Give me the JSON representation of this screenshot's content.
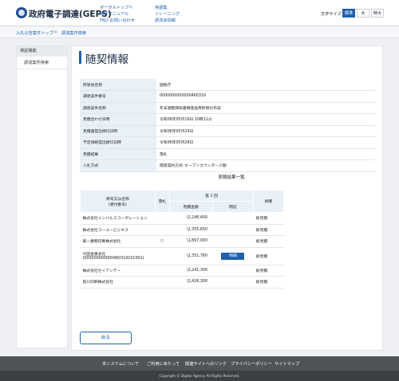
{
  "header": {
    "brand": "政府電子調達(GEPS)",
    "links_col1": [
      "ポータルトップへ",
      "操作マニュアル",
      "FAQ･お問い合わせ"
    ],
    "links_col2": [
      "用語集",
      "トレーニング",
      "調達会情報"
    ],
    "font_size_label": "文字サイズ",
    "font_sizes": [
      "標準",
      "大",
      "特大"
    ],
    "font_size_selected": "標準"
  },
  "breadcrumb": {
    "items": [
      "入札公告案件トップ",
      "調達案件検索"
    ],
    "separator": ">"
  },
  "sidebar": {
    "heading": "検証機能",
    "items": [
      "調達案件検索"
    ]
  },
  "page": {
    "title": "随契情報"
  },
  "info": [
    {
      "label": "所管省名称",
      "value": "国税庁"
    },
    {
      "label": "調達案件番号",
      "value": "0000000000000460319"
    },
    {
      "label": "調達案件名称",
      "value": "年末調整関係書類発送用封筒の作成"
    },
    {
      "label": "見積合わせ日時",
      "value": "令和06年05月16日 10時11分"
    },
    {
      "label": "見積書提出締切日時",
      "value": "令和06年05月29日"
    },
    {
      "label": "予定価格提出締切日時",
      "value": "令和06年05月28日"
    },
    {
      "label": "見積結果",
      "value": "落札"
    },
    {
      "label": "入札方式",
      "value": "随意契約方式･オープンカウンター少額"
    }
  ],
  "results": {
    "title": "見積結果一覧",
    "col_supplier": "商号又は名称",
    "col_supplier_sub": "(受付番号)",
    "col_award": "落札",
    "col_round": "第 1 回",
    "col_amount": "見積金額",
    "col_detail": "明記",
    "col_note": "摘要",
    "detail_button": "明細",
    "rows": [
      {
        "name": "株式会社インバルスコーポレーション",
        "award": "",
        "amount": "\\2,248,400",
        "detail": false,
        "note": "総見積"
      },
      {
        "name": "株式会社コーユービジネス",
        "award": "",
        "amount": "\\2,355,650",
        "detail": false,
        "note": "総見積"
      },
      {
        "name": "第一業務印刷株式会社",
        "award": "○",
        "amount": "\\1,897,000",
        "detail": false,
        "note": "総見積"
      },
      {
        "name": "今田金属会社",
        "name2": "(000000000000460319101001)",
        "award": "",
        "amount": "\\2,351,760",
        "detail": true,
        "note": "総見積"
      },
      {
        "name": "株式会社セイアンデー",
        "award": "",
        "amount": "\\2,241,300",
        "detail": false,
        "note": "総見積"
      },
      {
        "name": "前川印刷株式会社",
        "award": "",
        "amount": "\\2,426,300",
        "detail": false,
        "note": "総見積"
      }
    ]
  },
  "actions": {
    "back": "戻る"
  },
  "footer": {
    "links": [
      "本システムについて",
      "ご利用にあたって",
      "関連サイトへのリンク",
      "プライバシーポリシー",
      "サイトマップ"
    ],
    "copyright": "Copyright © Digital Agency All Rights Reserved."
  }
}
